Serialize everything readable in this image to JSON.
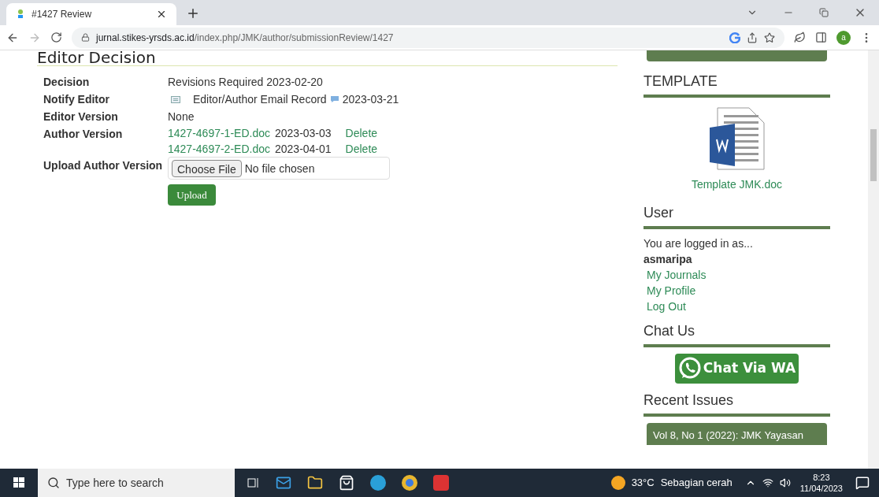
{
  "browser": {
    "tab": {
      "title": "#1427 Review"
    },
    "url": {
      "host": "jurnal.stikes-yrsds.ac.id",
      "path": "/index.php/JMK/author/submissionReview/1427"
    },
    "profile_initial": "a"
  },
  "main": {
    "heading": "Editor Decision",
    "rows": [
      {
        "kind": "text",
        "label": "Decision",
        "value": "Revisions Required 2023-02-20"
      },
      {
        "kind": "email",
        "label": "Notify Editor",
        "link": "Editor/Author Email Record",
        "date": "2023-03-21"
      },
      {
        "kind": "text",
        "label": "Editor Version",
        "value": "None"
      },
      {
        "kind": "files",
        "label": "Author Version",
        "files": [
          {
            "name": "1427-4697-1-ED.doc",
            "date": "2023-03-03",
            "action": "Delete"
          },
          {
            "name": "1427-4697-2-ED.doc",
            "date": "2023-04-01",
            "action": "Delete"
          }
        ]
      },
      {
        "kind": "upload",
        "label": "Upload Author Version",
        "choose": "Choose File",
        "status": "No file chosen",
        "button": "Upload"
      }
    ]
  },
  "sidebar": {
    "sections": [
      {
        "kind": "template",
        "title": "TEMPLATE",
        "link": "Template JMK.doc"
      },
      {
        "kind": "user",
        "title": "User",
        "text": "You are logged in as...",
        "username": "asmaripa",
        "links": [
          "My Journals",
          "My Profile",
          "Log Out"
        ]
      },
      {
        "kind": "chat",
        "title": "Chat Us",
        "button": "Chat Via WA"
      },
      {
        "kind": "issues",
        "title": "Recent Issues",
        "items": [
          "Vol 8, No 1 (2022): JMK Yayasan"
        ]
      }
    ]
  },
  "taskbar": {
    "search_placeholder": "Type here to search",
    "temperature": "33°C",
    "weather": "Sebagian cerah",
    "time": "8:23",
    "date": "11/04/2023"
  }
}
